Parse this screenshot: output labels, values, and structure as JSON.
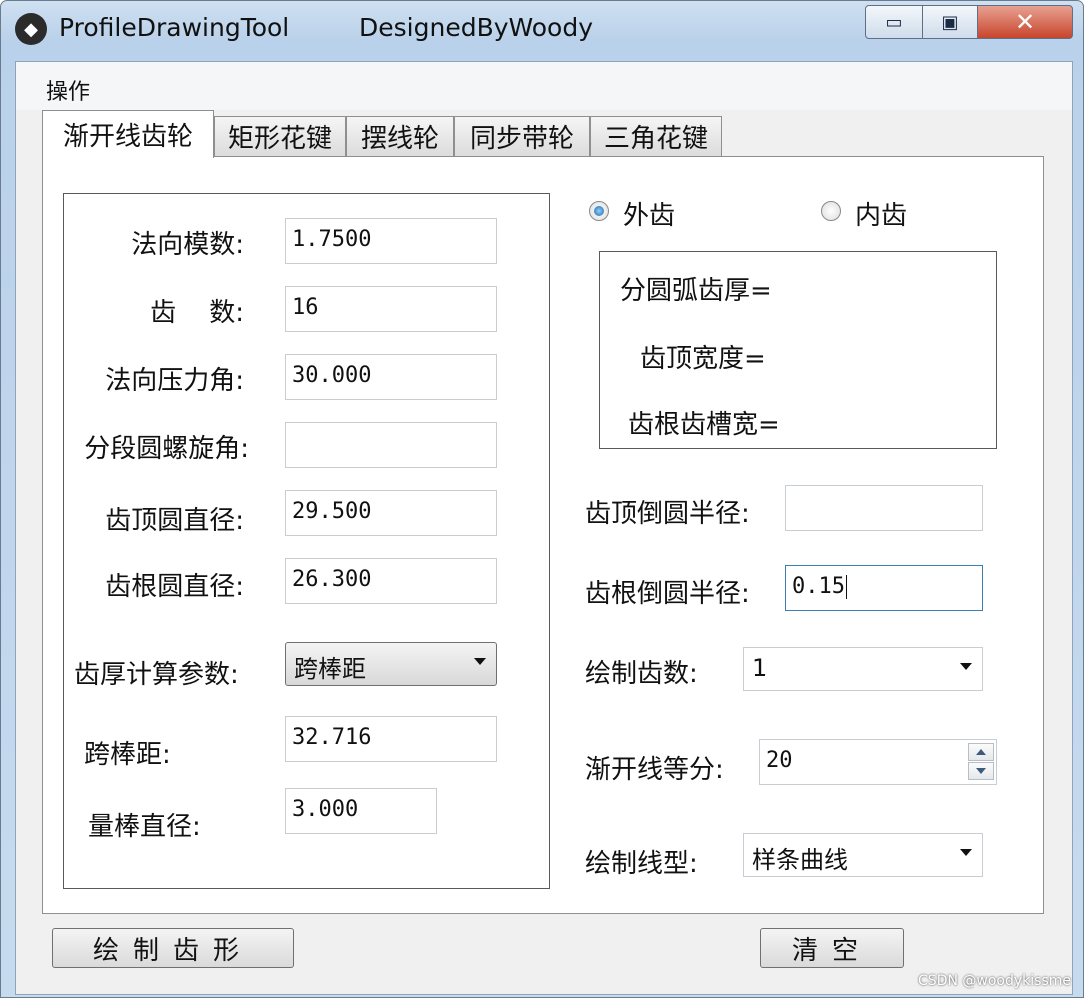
{
  "window": {
    "title_left": "ProfileDrawingTool",
    "title_right": "DesignedByWoody",
    "min_glyph": "▭",
    "max_glyph": "▣",
    "close_glyph": "✕",
    "icon_glyph": "◆"
  },
  "menu": {
    "items": [
      {
        "label": "操作"
      }
    ]
  },
  "tabs": [
    {
      "label": "渐开线齿轮",
      "active": true
    },
    {
      "label": "矩形花键",
      "active": false
    },
    {
      "label": "摆线轮",
      "active": false
    },
    {
      "label": "同步带轮",
      "active": false
    },
    {
      "label": "三角花键",
      "active": false
    }
  ],
  "left_group": {
    "fields": [
      {
        "label": "法向模数:",
        "value": "1.7500"
      },
      {
        "label": "齿    数:",
        "value": "16"
      },
      {
        "label": "法向压力角:",
        "value": "30.000"
      },
      {
        "label": "分段圆螺旋角:",
        "value": ""
      },
      {
        "label": "齿顶圆直径:",
        "value": "29.500"
      },
      {
        "label": "齿根圆直径:",
        "value": "26.300"
      }
    ],
    "calc_param": {
      "label": "齿厚计算参数:",
      "value": "跨棒距"
    },
    "span_distance": {
      "label": "跨棒距:",
      "value": "32.716"
    },
    "rod_diameter": {
      "label": "量棒直径:",
      "value": "3.000"
    }
  },
  "gear_type": {
    "external": {
      "label": "外齿",
      "checked": true
    },
    "internal": {
      "label": "内齿",
      "checked": false
    }
  },
  "info": {
    "arc_thickness": "分圆弧齿厚=",
    "tip_width": "齿顶宽度=",
    "root_slot_width": "齿根齿槽宽="
  },
  "right_fields": {
    "tip_fillet": {
      "label": "齿顶倒圆半径:",
      "value": ""
    },
    "root_fillet": {
      "label": "齿根倒圆半径:",
      "value": "0.15"
    },
    "draw_teeth": {
      "label": "绘制齿数:",
      "value": "1"
    },
    "involute_div": {
      "label": "渐开线等分:",
      "value": "20"
    },
    "line_type": {
      "label": "绘制线型:",
      "value": "样条曲线"
    }
  },
  "buttons": {
    "draw": "绘制齿形",
    "clear": "清空"
  },
  "watermark": "CSDN @woodykissme"
}
